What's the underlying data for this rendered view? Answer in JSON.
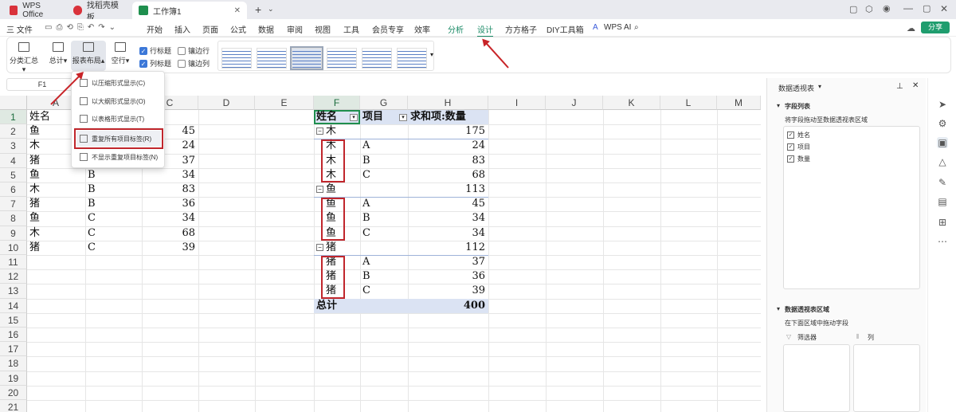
{
  "tabs": [
    {
      "label": "WPS Office",
      "color": "#d9323b"
    },
    {
      "label": "找稻壳模板",
      "color": "#d9323b"
    },
    {
      "label": "工作簿1",
      "color": "#1f8f4e"
    }
  ],
  "menu": {
    "file": "三 文件",
    "items": [
      "开始",
      "插入",
      "页面",
      "公式",
      "数据",
      "审阅",
      "视图",
      "工具",
      "会员专享",
      "效率",
      "分析",
      "设计",
      "方方格子",
      "DIY工具箱",
      "WPS AI"
    ],
    "share": "分享"
  },
  "ribbon": {
    "subtotal": "分类汇总",
    "total": "总计",
    "report_layout": "报表布局",
    "blank_rows": "空行",
    "row_headers": "行标题",
    "col_headers": "列标题",
    "banded_rows": "镶边行",
    "banded_cols": "镶边列"
  },
  "namebox": "F1",
  "dropdown": [
    "以压缩形式显示(C)",
    "以大纲形式显示(O)",
    "以表格形式显示(T)",
    "重复所有项目标签(R)",
    "不显示重复项目标签(N)"
  ],
  "columns": [
    "A",
    "B",
    "C",
    "D",
    "E",
    "F",
    "G",
    "H",
    "I",
    "J",
    "K",
    "L",
    "M"
  ],
  "rows": [
    "1",
    "2",
    "3",
    "4",
    "5",
    "6",
    "7",
    "8",
    "9",
    "10",
    "11",
    "12",
    "13",
    "14",
    "15",
    "16",
    "17",
    "18",
    "19",
    "20",
    "21"
  ],
  "source_table": [
    [
      "姓名",
      "",
      ""
    ],
    [
      "鱼",
      "",
      "45"
    ],
    [
      "木",
      "",
      "24"
    ],
    [
      "猪",
      "",
      "37"
    ],
    [
      "鱼",
      "B",
      "34"
    ],
    [
      "木",
      "B",
      "83"
    ],
    [
      "猪",
      "B",
      "36"
    ],
    [
      "鱼",
      "C",
      "34"
    ],
    [
      "木",
      "C",
      "68"
    ],
    [
      "猪",
      "C",
      "39"
    ]
  ],
  "pivot": {
    "h_name": "姓名",
    "h_item": "项目",
    "h_sum": "求和项:数量",
    "groups": [
      {
        "name": "木",
        "subtotal": "175",
        "rows": [
          [
            "木",
            "A",
            "24"
          ],
          [
            "木",
            "B",
            "83"
          ],
          [
            "木",
            "C",
            "68"
          ]
        ]
      },
      {
        "name": "鱼",
        "subtotal": "113",
        "rows": [
          [
            "鱼",
            "A",
            "45"
          ],
          [
            "鱼",
            "B",
            "34"
          ],
          [
            "鱼",
            "C",
            "34"
          ]
        ]
      },
      {
        "name": "猪",
        "subtotal": "112",
        "rows": [
          [
            "猪",
            "A",
            "37"
          ],
          [
            "猪",
            "B",
            "36"
          ],
          [
            "猪",
            "C",
            "39"
          ]
        ]
      }
    ],
    "total_label": "总计",
    "total_value": "400"
  },
  "pane": {
    "title": "数据透视表",
    "field_list": "字段列表",
    "drag_hint": "将字段拖动至数据透视表区域",
    "fields": [
      "姓名",
      "项目",
      "数量"
    ],
    "areas_title": "数据透视表区域",
    "areas_hint": "在下面区域中拖动字段",
    "filter": "筛选器",
    "column": "列"
  }
}
